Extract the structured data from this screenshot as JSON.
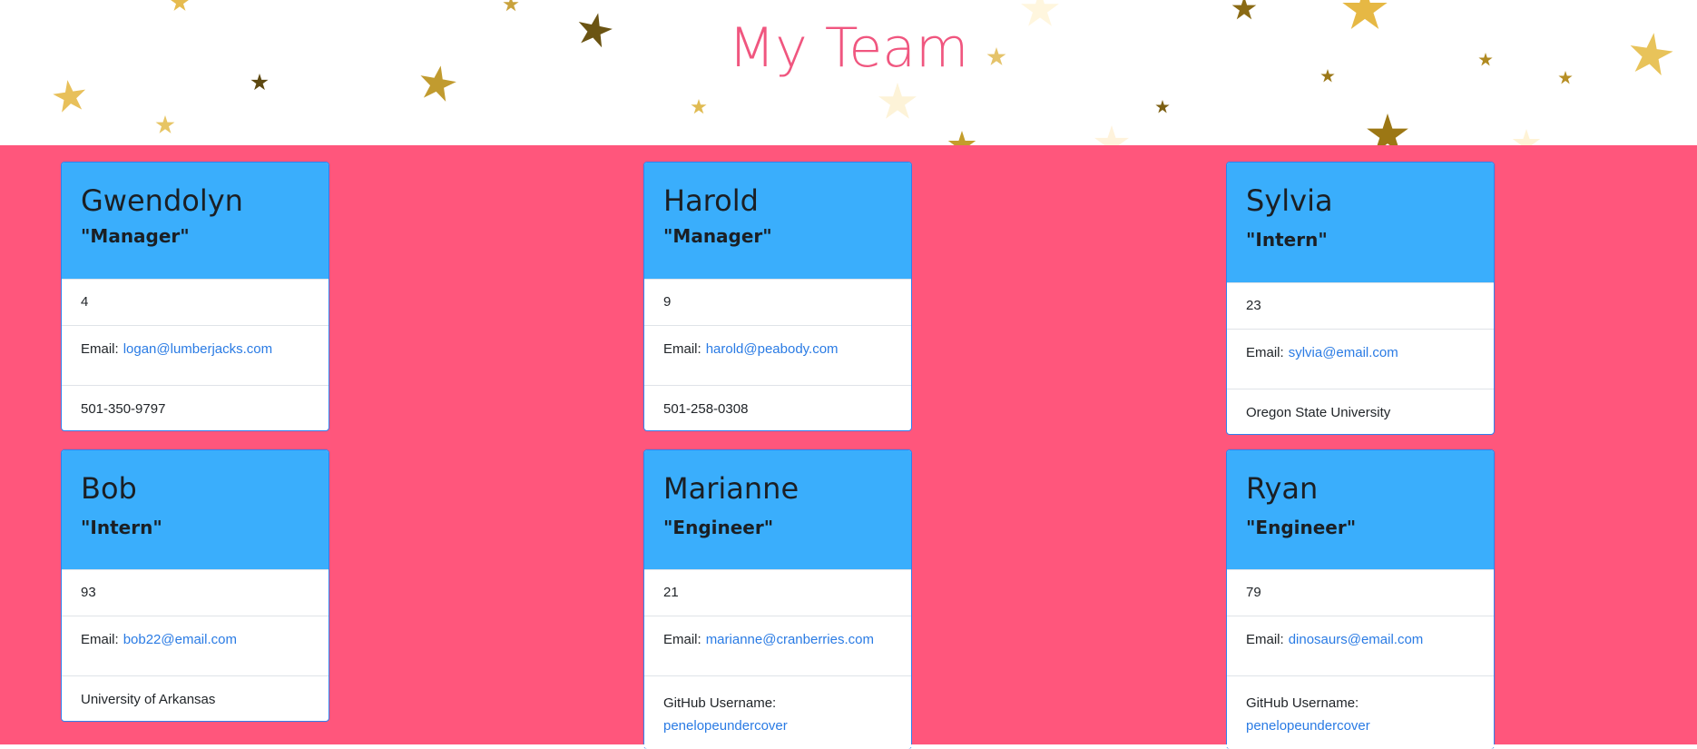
{
  "page": {
    "title": "My Team",
    "accent_color": "#f0567f",
    "background_color": "#ff567c",
    "card_header_color": "#3aaefc"
  },
  "labels": {
    "email": "Email:",
    "github": "GitHub Username:"
  },
  "employees": [
    {
      "name": "Gwendolyn",
      "role": "\"Manager\"",
      "id": "4",
      "email": "logan@lumberjacks.com",
      "extra": "501-350-9797",
      "extra_type": "office"
    },
    {
      "name": "Harold",
      "role": "\"Manager\"",
      "id": "9",
      "email": "harold@peabody.com",
      "extra": "501-258-0308",
      "extra_type": "office"
    },
    {
      "name": "Sylvia",
      "role": "\"Intern\"",
      "id": "23",
      "email": "sylvia@email.com",
      "extra": "Oregon State University",
      "extra_type": "school"
    },
    {
      "name": "Bob",
      "role": "\"Intern\"",
      "id": "93",
      "email": "bob22@email.com",
      "extra": "University of Arkansas",
      "extra_type": "school"
    },
    {
      "name": "Marianne",
      "role": "\"Engineer\"",
      "id": "21",
      "email": "marianne@cranberries.com",
      "extra": "penelopeundercover",
      "extra_type": "github"
    },
    {
      "name": "Ryan",
      "role": "\"Engineer\"",
      "id": "79",
      "email": "dinosaurs@email.com",
      "extra": "penelopeundercover",
      "extra_type": "github"
    }
  ]
}
